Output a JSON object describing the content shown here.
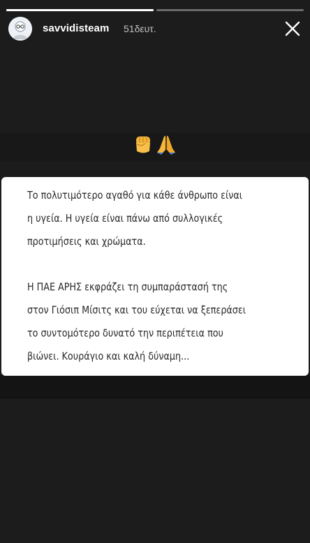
{
  "story": {
    "progress": [
      {
        "viewed": true
      },
      {
        "viewed": false
      }
    ],
    "header": {
      "username": "savvidisteam",
      "time_ago": "51δευτ.",
      "close_icon": "close-icon",
      "avatar_icon": "avatar-icon"
    },
    "emojis": [
      "raised-fist-icon",
      "folded-hands-icon"
    ],
    "card": {
      "paragraph1": [
        "Το πολυτιμότερο αγαθό για κάθε άνθρωπο είναι",
        "η υγεία. Η υγεία είναι πάνω από συλλογικές",
        "προτιμήσεις και χρώματα."
      ],
      "paragraph2": [
        "Η ΠΑΕ ΑΡΗΣ εκφράζει τη συμπαράστασή της",
        "στον Γιόσιπ Μίσιτς και του εύχεται να ξεπεράσει",
        "το συντομότερο δυνατό την περιπέτεια που",
        "βιώνει. Κουράγιο και καλή δύναμη..."
      ]
    },
    "colors": {
      "background": "#1c1c1c",
      "card": "#ffffff",
      "text": "#2a2a2a",
      "header_text": "#ffffff"
    }
  }
}
